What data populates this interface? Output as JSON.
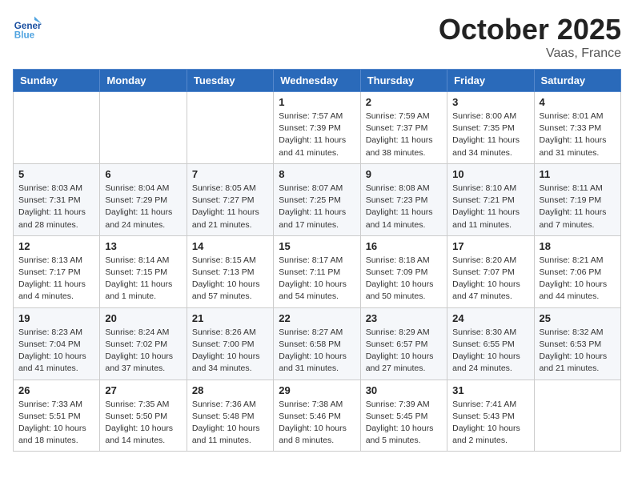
{
  "header": {
    "logo_general": "General",
    "logo_blue": "Blue",
    "month_title": "October 2025",
    "location": "Vaas, France"
  },
  "weekdays": [
    "Sunday",
    "Monday",
    "Tuesday",
    "Wednesday",
    "Thursday",
    "Friday",
    "Saturday"
  ],
  "weeks": [
    [
      {
        "day": "",
        "info": ""
      },
      {
        "day": "",
        "info": ""
      },
      {
        "day": "",
        "info": ""
      },
      {
        "day": "1",
        "info": "Sunrise: 7:57 AM\nSunset: 7:39 PM\nDaylight: 11 hours and 41 minutes."
      },
      {
        "day": "2",
        "info": "Sunrise: 7:59 AM\nSunset: 7:37 PM\nDaylight: 11 hours and 38 minutes."
      },
      {
        "day": "3",
        "info": "Sunrise: 8:00 AM\nSunset: 7:35 PM\nDaylight: 11 hours and 34 minutes."
      },
      {
        "day": "4",
        "info": "Sunrise: 8:01 AM\nSunset: 7:33 PM\nDaylight: 11 hours and 31 minutes."
      }
    ],
    [
      {
        "day": "5",
        "info": "Sunrise: 8:03 AM\nSunset: 7:31 PM\nDaylight: 11 hours and 28 minutes."
      },
      {
        "day": "6",
        "info": "Sunrise: 8:04 AM\nSunset: 7:29 PM\nDaylight: 11 hours and 24 minutes."
      },
      {
        "day": "7",
        "info": "Sunrise: 8:05 AM\nSunset: 7:27 PM\nDaylight: 11 hours and 21 minutes."
      },
      {
        "day": "8",
        "info": "Sunrise: 8:07 AM\nSunset: 7:25 PM\nDaylight: 11 hours and 17 minutes."
      },
      {
        "day": "9",
        "info": "Sunrise: 8:08 AM\nSunset: 7:23 PM\nDaylight: 11 hours and 14 minutes."
      },
      {
        "day": "10",
        "info": "Sunrise: 8:10 AM\nSunset: 7:21 PM\nDaylight: 11 hours and 11 minutes."
      },
      {
        "day": "11",
        "info": "Sunrise: 8:11 AM\nSunset: 7:19 PM\nDaylight: 11 hours and 7 minutes."
      }
    ],
    [
      {
        "day": "12",
        "info": "Sunrise: 8:13 AM\nSunset: 7:17 PM\nDaylight: 11 hours and 4 minutes."
      },
      {
        "day": "13",
        "info": "Sunrise: 8:14 AM\nSunset: 7:15 PM\nDaylight: 11 hours and 1 minute."
      },
      {
        "day": "14",
        "info": "Sunrise: 8:15 AM\nSunset: 7:13 PM\nDaylight: 10 hours and 57 minutes."
      },
      {
        "day": "15",
        "info": "Sunrise: 8:17 AM\nSunset: 7:11 PM\nDaylight: 10 hours and 54 minutes."
      },
      {
        "day": "16",
        "info": "Sunrise: 8:18 AM\nSunset: 7:09 PM\nDaylight: 10 hours and 50 minutes."
      },
      {
        "day": "17",
        "info": "Sunrise: 8:20 AM\nSunset: 7:07 PM\nDaylight: 10 hours and 47 minutes."
      },
      {
        "day": "18",
        "info": "Sunrise: 8:21 AM\nSunset: 7:06 PM\nDaylight: 10 hours and 44 minutes."
      }
    ],
    [
      {
        "day": "19",
        "info": "Sunrise: 8:23 AM\nSunset: 7:04 PM\nDaylight: 10 hours and 41 minutes."
      },
      {
        "day": "20",
        "info": "Sunrise: 8:24 AM\nSunset: 7:02 PM\nDaylight: 10 hours and 37 minutes."
      },
      {
        "day": "21",
        "info": "Sunrise: 8:26 AM\nSunset: 7:00 PM\nDaylight: 10 hours and 34 minutes."
      },
      {
        "day": "22",
        "info": "Sunrise: 8:27 AM\nSunset: 6:58 PM\nDaylight: 10 hours and 31 minutes."
      },
      {
        "day": "23",
        "info": "Sunrise: 8:29 AM\nSunset: 6:57 PM\nDaylight: 10 hours and 27 minutes."
      },
      {
        "day": "24",
        "info": "Sunrise: 8:30 AM\nSunset: 6:55 PM\nDaylight: 10 hours and 24 minutes."
      },
      {
        "day": "25",
        "info": "Sunrise: 8:32 AM\nSunset: 6:53 PM\nDaylight: 10 hours and 21 minutes."
      }
    ],
    [
      {
        "day": "26",
        "info": "Sunrise: 7:33 AM\nSunset: 5:51 PM\nDaylight: 10 hours and 18 minutes."
      },
      {
        "day": "27",
        "info": "Sunrise: 7:35 AM\nSunset: 5:50 PM\nDaylight: 10 hours and 14 minutes."
      },
      {
        "day": "28",
        "info": "Sunrise: 7:36 AM\nSunset: 5:48 PM\nDaylight: 10 hours and 11 minutes."
      },
      {
        "day": "29",
        "info": "Sunrise: 7:38 AM\nSunset: 5:46 PM\nDaylight: 10 hours and 8 minutes."
      },
      {
        "day": "30",
        "info": "Sunrise: 7:39 AM\nSunset: 5:45 PM\nDaylight: 10 hours and 5 minutes."
      },
      {
        "day": "31",
        "info": "Sunrise: 7:41 AM\nSunset: 5:43 PM\nDaylight: 10 hours and 2 minutes."
      },
      {
        "day": "",
        "info": ""
      }
    ]
  ]
}
